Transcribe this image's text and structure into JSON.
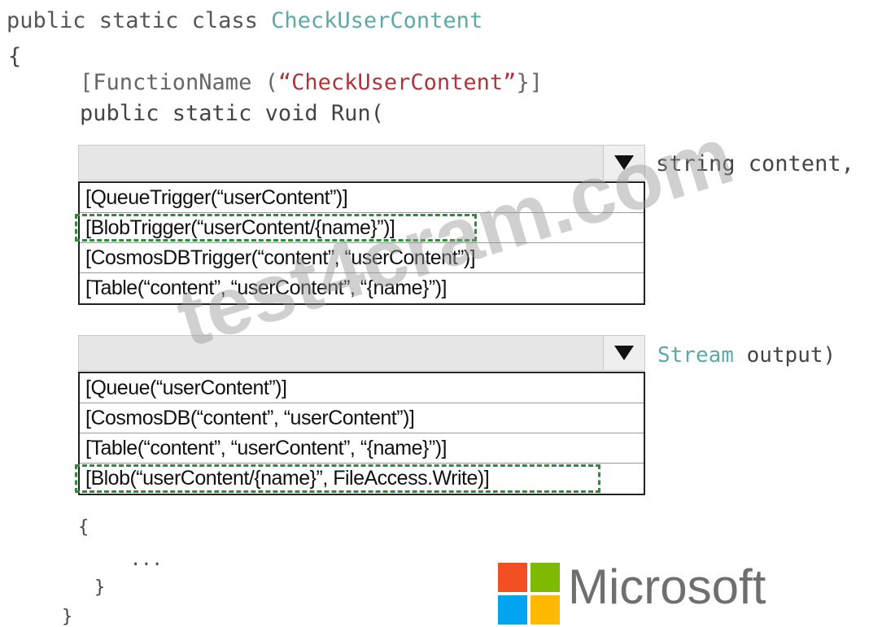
{
  "code": {
    "line1_kw": "public static class ",
    "line1_class": "CheckUserContent",
    "open_brace": "{",
    "attr_open": "[FunctionName (",
    "attr_string": "“CheckUserContent”",
    "attr_close": "}]",
    "method_sig": "public static void Run(",
    "param1_suffix": "string content,",
    "param2_type": "Stream",
    "param2_suffix": " output)",
    "body_open": "{",
    "body_ellipsis": "...",
    "body_close": "}",
    "class_close": "}"
  },
  "dropdown1": {
    "selected_value": "",
    "options": [
      "[QueueTrigger(“userContent”)]",
      "[BlobTrigger(“userContent/{name}”)]",
      "[CosmosDBTrigger(“content”, “userContent”)]",
      "[Table(“content”, “userContent”, “{name}”)]"
    ],
    "highlighted_index": 1
  },
  "dropdown2": {
    "selected_value": "",
    "options": [
      "[Queue(“userContent”)]",
      "[CosmosDB(“content”, “userContent”)]",
      "[Table(“content”, “userContent”, “{name}”)]",
      "[Blob(“userContent/{name}”, FileAccess.Write)]"
    ],
    "highlighted_index": 3
  },
  "watermark": "test4cram.com",
  "logo": {
    "text": "Microsoft",
    "colors": [
      "#f25022",
      "#7fba00",
      "#00a4ef",
      "#ffb900"
    ]
  },
  "colors": {
    "type_name": "#5fa8a8",
    "string_literal": "#b0343c",
    "selection_outline": "#2f8a3a"
  },
  "icons": {
    "dropdown_arrow": "triangle-down-icon"
  }
}
